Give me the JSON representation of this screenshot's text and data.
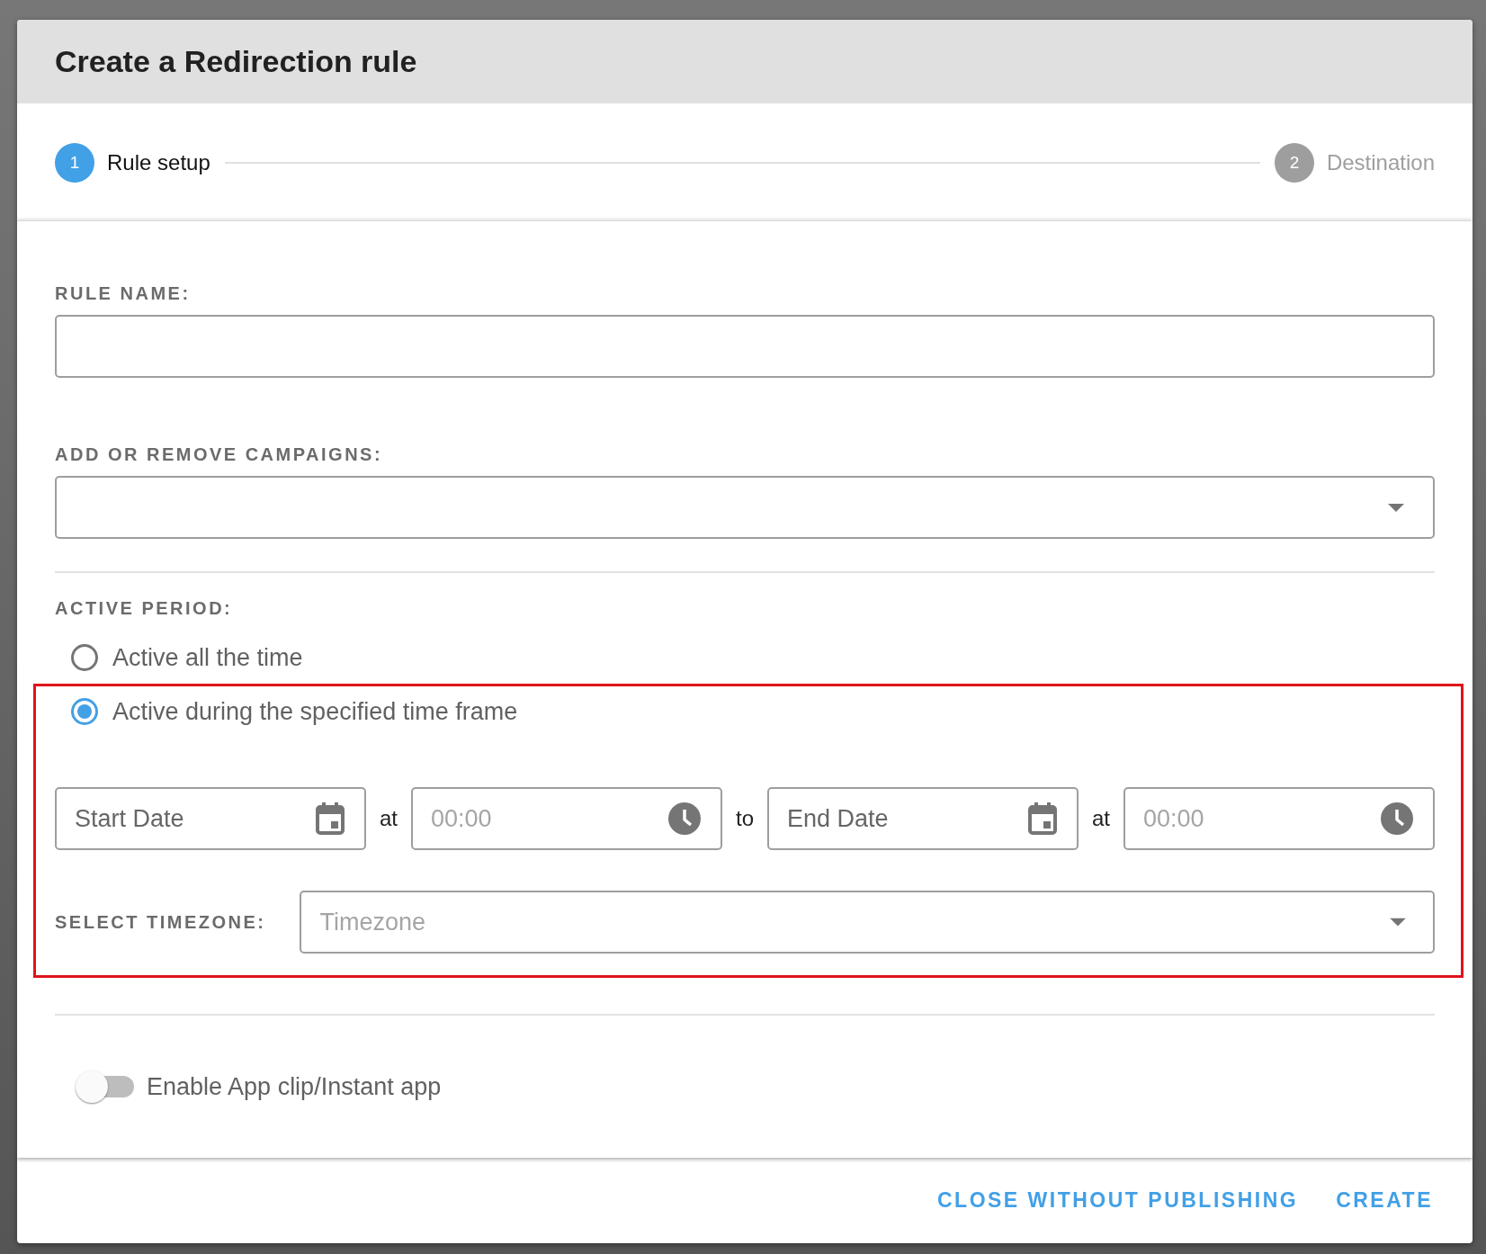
{
  "dialog": {
    "title": "Create a Redirection rule"
  },
  "stepper": [
    {
      "number": "1",
      "label": "Rule setup",
      "selected": true
    },
    {
      "number": "2",
      "label": "Destination",
      "selected": false
    }
  ],
  "rule_name": {
    "label": "RULE NAME:"
  },
  "campaigns": {
    "label": "ADD OR REMOVE CAMPAIGNS:"
  },
  "active_period": {
    "label": "ACTIVE PERIOD:",
    "options": [
      {
        "label": "Active all the time",
        "selected": false
      },
      {
        "label": "Active during the specified time frame",
        "selected": true
      }
    ]
  },
  "time_frame": [
    {
      "kind": "date",
      "placeholder": "Start Date"
    },
    {
      "kind": "word",
      "text": "at"
    },
    {
      "kind": "time",
      "placeholder": "00:00"
    },
    {
      "kind": "word",
      "text": "to"
    },
    {
      "kind": "date",
      "placeholder": "End Date"
    },
    {
      "kind": "word",
      "text": "at"
    },
    {
      "kind": "time",
      "placeholder": "00:00"
    }
  ],
  "timezone": {
    "label": "SELECT TIMEZONE:",
    "placeholder": "Timezone"
  },
  "app_clip": {
    "label": "Enable App clip/Instant app",
    "on": false
  },
  "buttons": [
    {
      "label": "CLOSE WITHOUT PUBLISHING"
    },
    {
      "label": "CREATE"
    }
  ]
}
